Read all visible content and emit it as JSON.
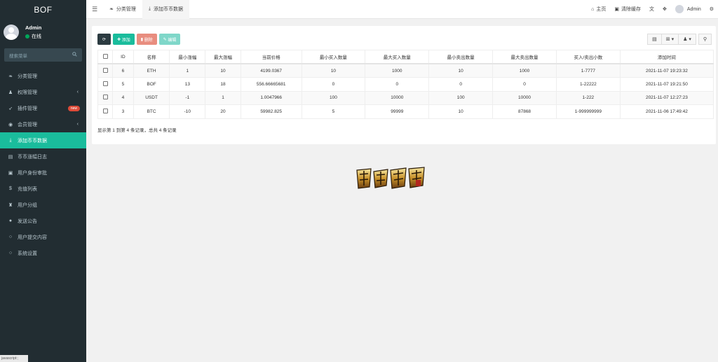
{
  "app": {
    "logo": "BOF"
  },
  "user": {
    "name": "Admin",
    "status": "在线"
  },
  "sidebar": {
    "search_placeholder": "搜索菜单",
    "items": [
      {
        "label": "分类管理",
        "icon": "leaf-icon"
      },
      {
        "label": "权限管理",
        "icon": "users-icon",
        "has_caret": true
      },
      {
        "label": "插件管理",
        "icon": "rocket-icon",
        "badge": "new"
      },
      {
        "label": "会员管理",
        "icon": "user-circle-icon",
        "has_caret": true
      },
      {
        "label": "添加币币数据",
        "icon": "download-icon",
        "active": true
      },
      {
        "label": "币币涨幅日志",
        "icon": "list-icon"
      },
      {
        "label": "用户身份审批",
        "icon": "id-card-icon"
      },
      {
        "label": "充值列表",
        "icon": "dollar-icon"
      },
      {
        "label": "用户分组",
        "icon": "group-icon"
      },
      {
        "label": "发送公告",
        "icon": "megaphone-icon"
      },
      {
        "label": "用户提交内容",
        "icon": "circle-icon"
      },
      {
        "label": "系统设置",
        "icon": "circle-icon"
      }
    ],
    "footer_hint": "javascript:;"
  },
  "topbar": {
    "tabs": [
      {
        "label": "分类管理",
        "icon": "leaf-icon"
      },
      {
        "label": "添加币币数据",
        "icon": "download-icon",
        "active": true
      }
    ],
    "right": {
      "home": "主页",
      "clear_cache": "清除缓存",
      "user": "Admin"
    }
  },
  "toolbar": {
    "add": "添加",
    "delete": "删除",
    "edit": "编辑"
  },
  "table": {
    "headers": [
      "ID",
      "名称",
      "最小涨幅",
      "最大涨幅",
      "当前价格",
      "最小买入数量",
      "最大买入数量",
      "最小卖出数量",
      "最大卖出数量",
      "买入/卖出小数",
      "添加时间"
    ],
    "rows": [
      [
        "6",
        "ETH",
        "1",
        "10",
        "4199.0367",
        "10",
        "1000",
        "10",
        "1000",
        "1-7777",
        "2021-11-07 19:23:32"
      ],
      [
        "5",
        "BOF",
        "13",
        "18",
        "556.66665681",
        "0",
        "0",
        "0",
        "0",
        "1-22222",
        "2021-11-07 19:21:50"
      ],
      [
        "4",
        "USDT",
        "-1",
        "1",
        "1.0047966",
        "100",
        "10000",
        "100",
        "10000",
        "1-222",
        "2021-11-07 12:27:23"
      ],
      [
        "3",
        "BTC",
        "-10",
        "20",
        "59982.825",
        "5",
        "99999",
        "10",
        "87868",
        "1-999999999",
        "2021-11-06 17:49:42"
      ]
    ]
  },
  "pager": {
    "summary": "显示第 1 到第 4 条记录，总共 4 条记录"
  }
}
